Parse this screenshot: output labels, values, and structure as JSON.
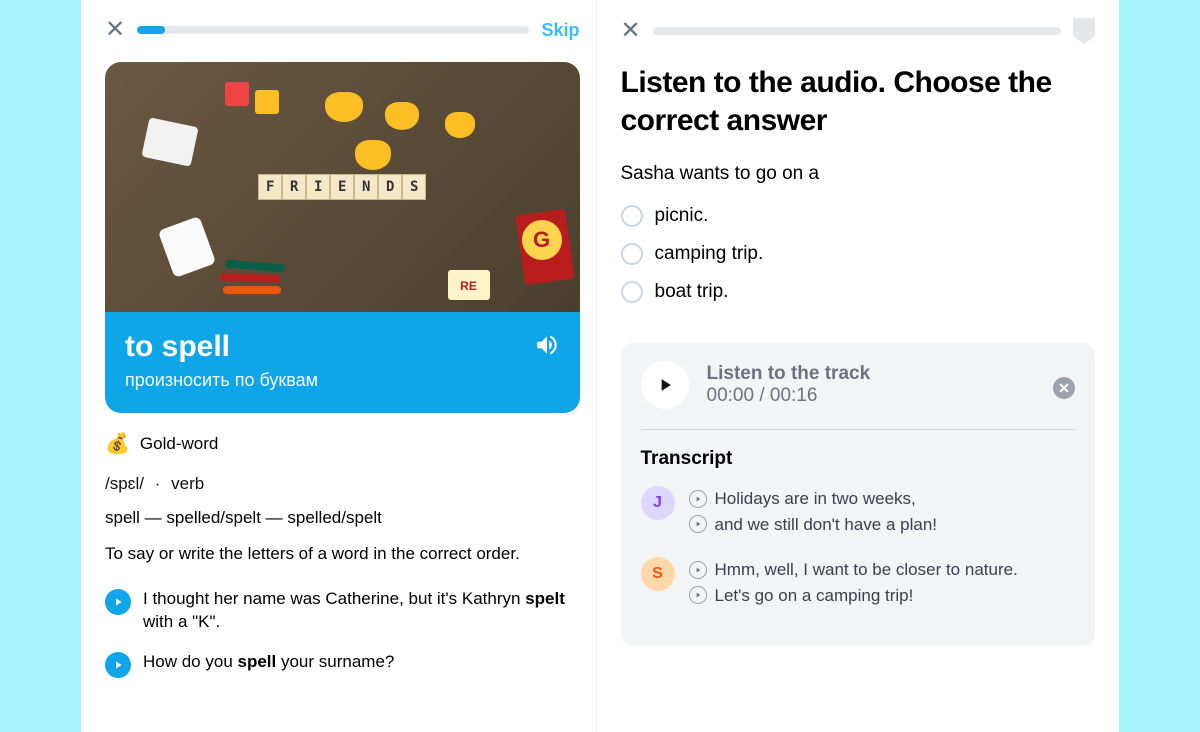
{
  "left": {
    "skip": "Skip",
    "progress_pct": 7,
    "tiles": [
      "F",
      "R",
      "I",
      "E",
      "N",
      "D",
      "S"
    ],
    "card": {
      "word": "to spell",
      "translation": "произносить по буквам"
    },
    "gold_label": "Gold-word",
    "gold_emoji": "💰",
    "phonetic": "/spɛl/",
    "pos": "verb",
    "forms": "spell — spelled/spelt — spelled/spelt",
    "definition": "To say or write the letters of a word in the correct order.",
    "examples": [
      {
        "pre": "I thought her name was Catherine, but it's Kathryn ",
        "bold": "spelt",
        "post": " with a \"K\"."
      },
      {
        "pre": "How do you ",
        "bold": "spell",
        "post": " your surname?"
      }
    ]
  },
  "right": {
    "title": "Listen to the audio. Choose the correct answer",
    "prompt": "Sasha wants to go on a",
    "options": [
      "picnic.",
      "camping trip.",
      "boat trip."
    ],
    "player": {
      "title": "Listen to the track",
      "time": "00:00 / 00:16"
    },
    "transcript_title": "Transcript",
    "speakers": [
      {
        "initial": "J",
        "cls": "j",
        "lines": [
          "Holidays are in two weeks,",
          "and we still don't have a plan!"
        ]
      },
      {
        "initial": "S",
        "cls": "s",
        "lines": [
          "Hmm, well, I want to be closer to nature.",
          "Let's go on a camping trip!"
        ]
      }
    ]
  }
}
